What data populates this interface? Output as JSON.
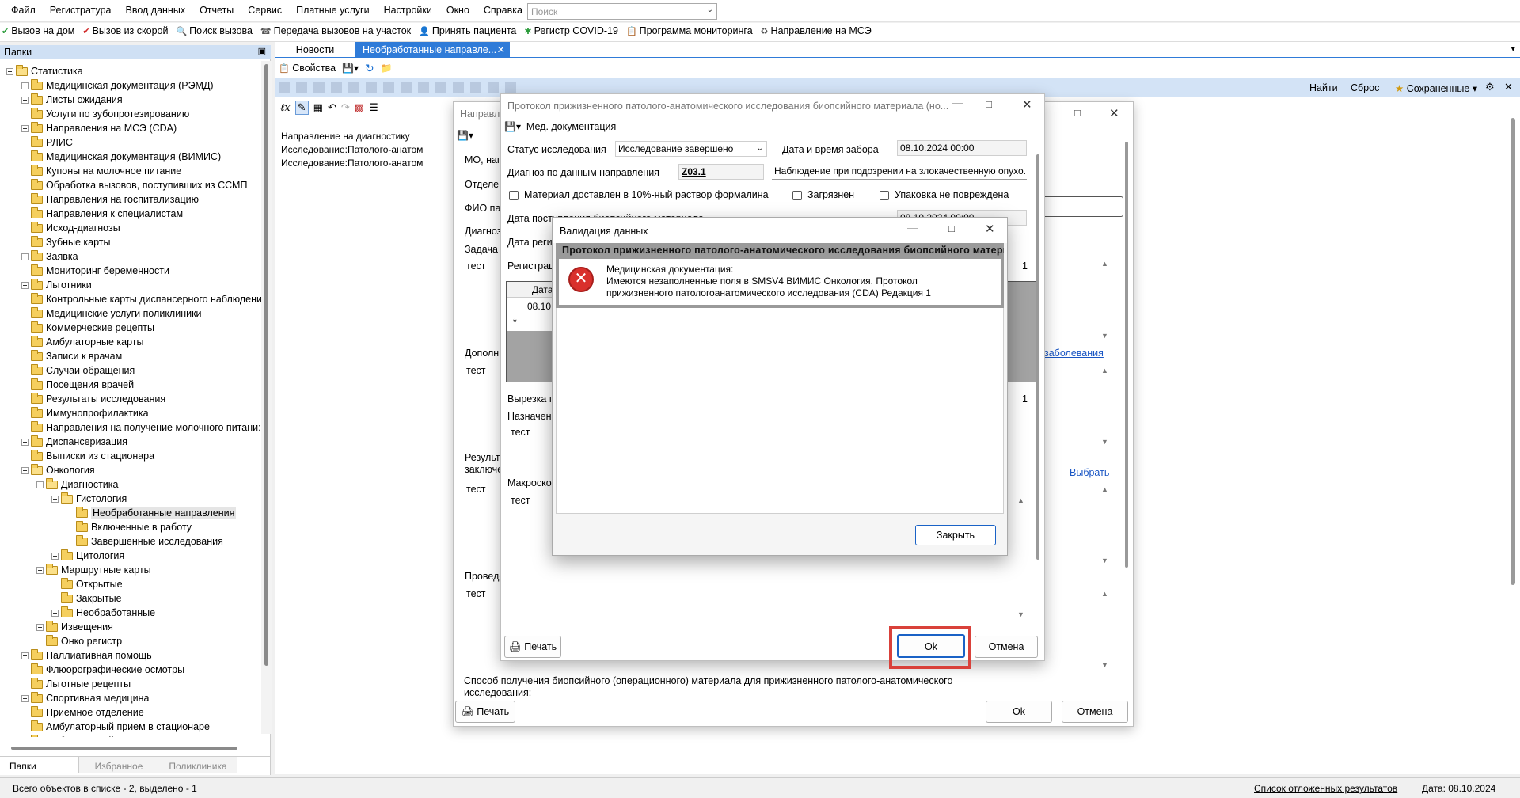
{
  "menu": [
    "Файл",
    "Регистратура",
    "Ввод данных",
    "Отчеты",
    "Сервис",
    "Платные услуги",
    "Настройки",
    "Окно",
    "Справка"
  ],
  "search": {
    "placeholder": "Поиск"
  },
  "toolbar": [
    "Вызов на дом",
    "Вызов из скорой",
    "Поиск вызова",
    "Передача вызовов на участок",
    "Принять пациента",
    "Регистр COVID-19",
    "Программа мониторинга",
    "Направление на МСЭ"
  ],
  "left_panel": {
    "title": "Папки",
    "tree": [
      {
        "label": "Статистика",
        "level": 0,
        "exp": "minus"
      },
      {
        "label": "Медицинская документация (РЭМД)",
        "level": 1,
        "exp": "plus"
      },
      {
        "label": "Листы ожидания",
        "level": 1,
        "exp": "plus"
      },
      {
        "label": "Услуги по зубопротезированию",
        "level": 1,
        "exp": "none"
      },
      {
        "label": "Направления на МСЭ (CDA)",
        "level": 1,
        "exp": "plus"
      },
      {
        "label": "РЛИС",
        "level": 1,
        "exp": "none"
      },
      {
        "label": "Медицинская документация (ВИМИС)",
        "level": 1,
        "exp": "none"
      },
      {
        "label": "Купоны на молочное питание",
        "level": 1,
        "exp": "none"
      },
      {
        "label": "Обработка вызовов, поступивших из ССМП",
        "level": 1,
        "exp": "none"
      },
      {
        "label": "Направления на госпитализацию",
        "level": 1,
        "exp": "none"
      },
      {
        "label": "Направления к специалистам",
        "level": 1,
        "exp": "none"
      },
      {
        "label": "Исход-диагнозы",
        "level": 1,
        "exp": "none"
      },
      {
        "label": "Зубные карты",
        "level": 1,
        "exp": "none"
      },
      {
        "label": "Заявка",
        "level": 1,
        "exp": "plus"
      },
      {
        "label": "Мониторинг беременности",
        "level": 1,
        "exp": "none"
      },
      {
        "label": "Льготники",
        "level": 1,
        "exp": "plus"
      },
      {
        "label": "Контрольные карты диспансерного наблюдени",
        "level": 1,
        "exp": "none"
      },
      {
        "label": "Медицинские услуги поликлиники",
        "level": 1,
        "exp": "none"
      },
      {
        "label": "Коммерческие рецепты",
        "level": 1,
        "exp": "none"
      },
      {
        "label": "Амбулаторные карты",
        "level": 1,
        "exp": "none"
      },
      {
        "label": "Записи к врачам",
        "level": 1,
        "exp": "none"
      },
      {
        "label": "Случаи обращения",
        "level": 1,
        "exp": "none"
      },
      {
        "label": "Посещения врачей",
        "level": 1,
        "exp": "none"
      },
      {
        "label": "Результаты исследования",
        "level": 1,
        "exp": "none"
      },
      {
        "label": "Иммунопрофилактика",
        "level": 1,
        "exp": "none"
      },
      {
        "label": "Направления на получение молочного питани:",
        "level": 1,
        "exp": "none"
      },
      {
        "label": "Диспансеризация",
        "level": 1,
        "exp": "plus"
      },
      {
        "label": "Выписки из стационара",
        "level": 1,
        "exp": "none"
      },
      {
        "label": "Онкология",
        "level": 1,
        "exp": "minus"
      },
      {
        "label": "Диагностика",
        "level": 2,
        "exp": "minus"
      },
      {
        "label": "Гистология",
        "level": 3,
        "exp": "minus"
      },
      {
        "label": "Необработанные направления",
        "level": 4,
        "exp": "none",
        "selected": true
      },
      {
        "label": "Включенные в работу",
        "level": 4,
        "exp": "none"
      },
      {
        "label": "Завершенные исследования",
        "level": 4,
        "exp": "none"
      },
      {
        "label": "Цитология",
        "level": 3,
        "exp": "plus"
      },
      {
        "label": "Маршрутные карты",
        "level": 2,
        "exp": "minus"
      },
      {
        "label": "Открытые",
        "level": 3,
        "exp": "none"
      },
      {
        "label": "Закрытые",
        "level": 3,
        "exp": "none"
      },
      {
        "label": "Необработанные",
        "level": 3,
        "exp": "plus"
      },
      {
        "label": "Извещения",
        "level": 2,
        "exp": "plus"
      },
      {
        "label": "Онко регистр",
        "level": 2,
        "exp": "none"
      },
      {
        "label": "Паллиативная помощь",
        "level": 1,
        "exp": "plus"
      },
      {
        "label": "Флюорографические осмотры",
        "level": 1,
        "exp": "none"
      },
      {
        "label": "Льготные рецепты",
        "level": 1,
        "exp": "none"
      },
      {
        "label": "Спортивная медицина",
        "level": 1,
        "exp": "plus"
      },
      {
        "label": "Приемное отделение",
        "level": 1,
        "exp": "none"
      },
      {
        "label": "Амбулаторный прием в стационаре",
        "level": 1,
        "exp": "none"
      },
      {
        "label": "Амбулаторный прием",
        "level": 1,
        "exp": "none"
      }
    ],
    "tabs": [
      "Папки",
      "Избранное",
      "Поликлиника"
    ]
  },
  "doc_tabs": [
    "Новости",
    "Необработанные направле..."
  ],
  "content_toolbar": {
    "properties": "Свойства"
  },
  "filter_bar": {
    "find": "Найти",
    "reset": "Сброс",
    "saved": "Сохраненные"
  },
  "list": {
    "header": "Направление на диагностику",
    "rows": [
      "Исследование:Патолого-анатомическ",
      "Исследование:Патолого-анатомическ"
    ]
  },
  "dlg_back": {
    "title": "Направле",
    "labels": [
      "МО, напр",
      "Отделен",
      "ФИО па",
      "Диагноз",
      "Задача п",
      "Дополни",
      "Результ заключе",
      "Проведё"
    ],
    "values": [
      "тест",
      "тест",
      "тест",
      "тест"
    ],
    "link_disease": "заболевания",
    "link_choose": "Выбрать",
    "method_label": "Способ получения биопсийного (операционного) материала для прижизненного патолого-анатомического исследования:",
    "print": "Печать",
    "ok": "Ok",
    "cancel": "Отмена"
  },
  "dlg_protocol": {
    "title": "Протокол прижизненного патолого-анатомического исследования биопсийного материала (но...",
    "menu": "Мед. документация",
    "status_label": "Статус исследования",
    "status_value": "Исследование завершено",
    "date_take_label": "Дата и время забора",
    "date_take_value": "08.10.2024 00:00",
    "diag_label": "Диагноз по данным направления",
    "diag_value": "Z03.1",
    "diag_desc": "Наблюдение при подозрении на злокачественную опухо.",
    "chk_formalin": "Материал доставлен в 10%-ный раствор формалина",
    "chk_dirty": "Загрязнен",
    "chk_pack": "Упаковка не повреждена",
    "date_recv_label": "Дата поступления биопсийного материала",
    "date_recv_value": "08.10.2024 00:00",
    "date_reg_label": "Дата регис",
    "reg_label": "Регистрац",
    "reg_count": "1",
    "grid_header": "Дата",
    "grid_row": "08.10.",
    "grid_new": "*",
    "cut_label": "Вырезка п",
    "cut_count": "1",
    "purpose_label": "Назначени",
    "purpose_value": "тест",
    "macro_label": "Макроско",
    "macro_value": "тест",
    "print": "Печать",
    "ok": "Ok",
    "cancel": "Отмена"
  },
  "dlg_validation": {
    "title": "Валидация данных",
    "header": "Протокол прижизненного патолого-анатомического исследования биопсийного материала",
    "message_line1": "Медицинская документация:",
    "message_line2": "Имеются незаполненные поля в SMSV4 ВИМИС Онкология. Протокол",
    "message_line3": "прижизненного патологоанатомического исследования (CDA) Редакция 1",
    "close": "Закрыть"
  },
  "status_bar": {
    "count": "Всего объектов в списке - 2, выделено - 1",
    "deferred": "Список отложенных результатов",
    "date": "Дата: 08.10.2024"
  }
}
